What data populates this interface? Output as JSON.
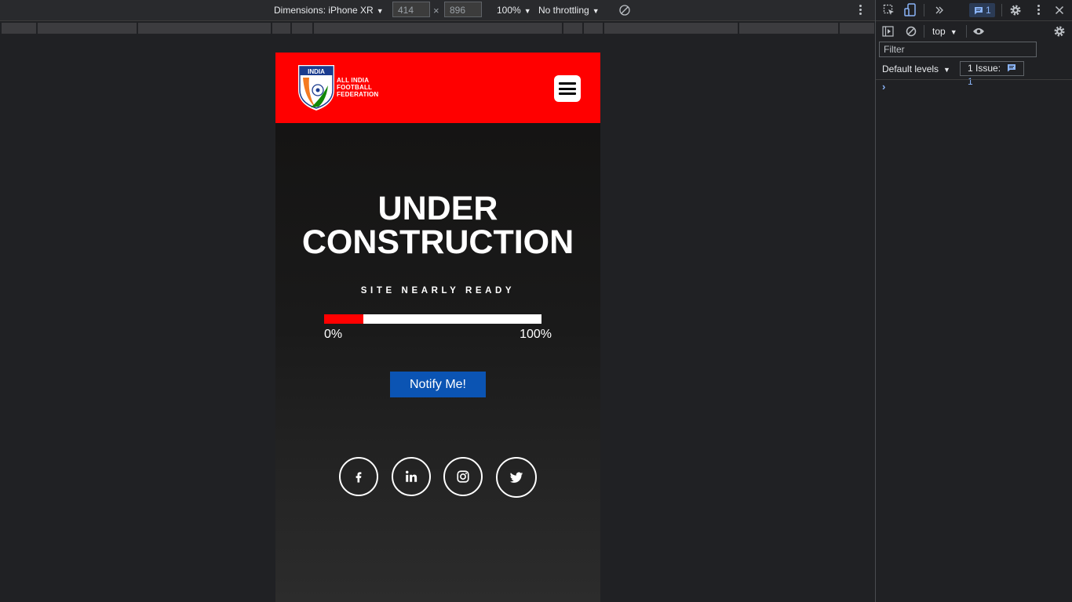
{
  "device_toolbar": {
    "dimensions_label": "Dimensions: iPhone XR",
    "width_value": "414",
    "times": "×",
    "height_value": "896",
    "zoom": "100%",
    "throttling": "No throttling"
  },
  "site": {
    "header_bg": "#ff0000",
    "logo": {
      "badge_text": "INDIA",
      "line1": "ALL INDIA",
      "line2": "FOOTBALL",
      "line3": "FEDERATION"
    },
    "menu_icon": "hamburger-icon",
    "hero_line1": "UNDER",
    "hero_line2": "CONSTRUCTION",
    "subtitle": "SITE NEARLY READY",
    "progress": {
      "fraction": 0.18,
      "label_start": "0%",
      "label_end": "100%",
      "fill_color": "#ff0000"
    },
    "notify_label": "Notify Me!",
    "notify_color": "#0b54b3",
    "social": [
      "facebook-icon",
      "linkedin-icon",
      "instagram-icon",
      "twitter-icon"
    ]
  },
  "devtools": {
    "issue_count": "1",
    "context": "top",
    "filter_placeholder": "Filter",
    "levels": "Default levels",
    "issues_label": "1 Issue:",
    "issues_count": "1",
    "prompt": "›"
  }
}
